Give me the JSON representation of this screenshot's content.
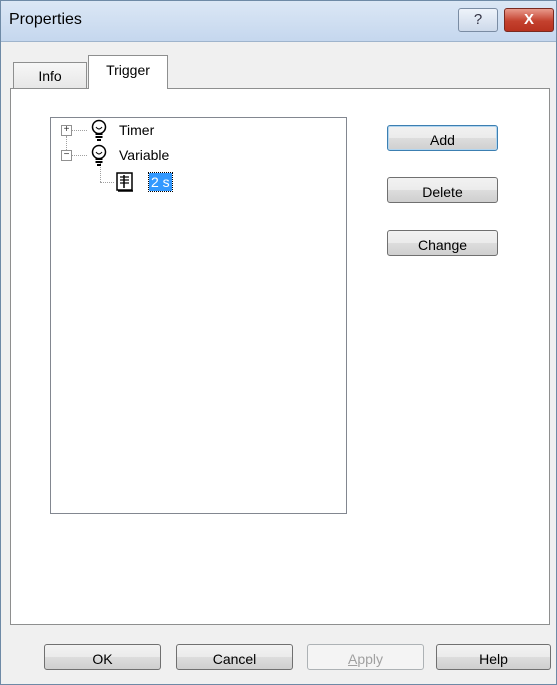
{
  "window": {
    "title": "Properties"
  },
  "titlebar": {
    "help_label": "?",
    "close_label": "X"
  },
  "tabs": [
    {
      "label": "Info"
    },
    {
      "label": "Trigger"
    }
  ],
  "tree": {
    "nodes": [
      {
        "label": "Timer",
        "expander": "+"
      },
      {
        "label": "Variable",
        "expander": "−",
        "children": [
          {
            "label": "2 s"
          }
        ]
      }
    ]
  },
  "side_buttons": {
    "add": "Add",
    "delete": "Delete",
    "change": "Change"
  },
  "footer": {
    "ok": "OK",
    "cancel": "Cancel",
    "apply_first": "A",
    "apply_rest": "pply",
    "help": "Help"
  }
}
